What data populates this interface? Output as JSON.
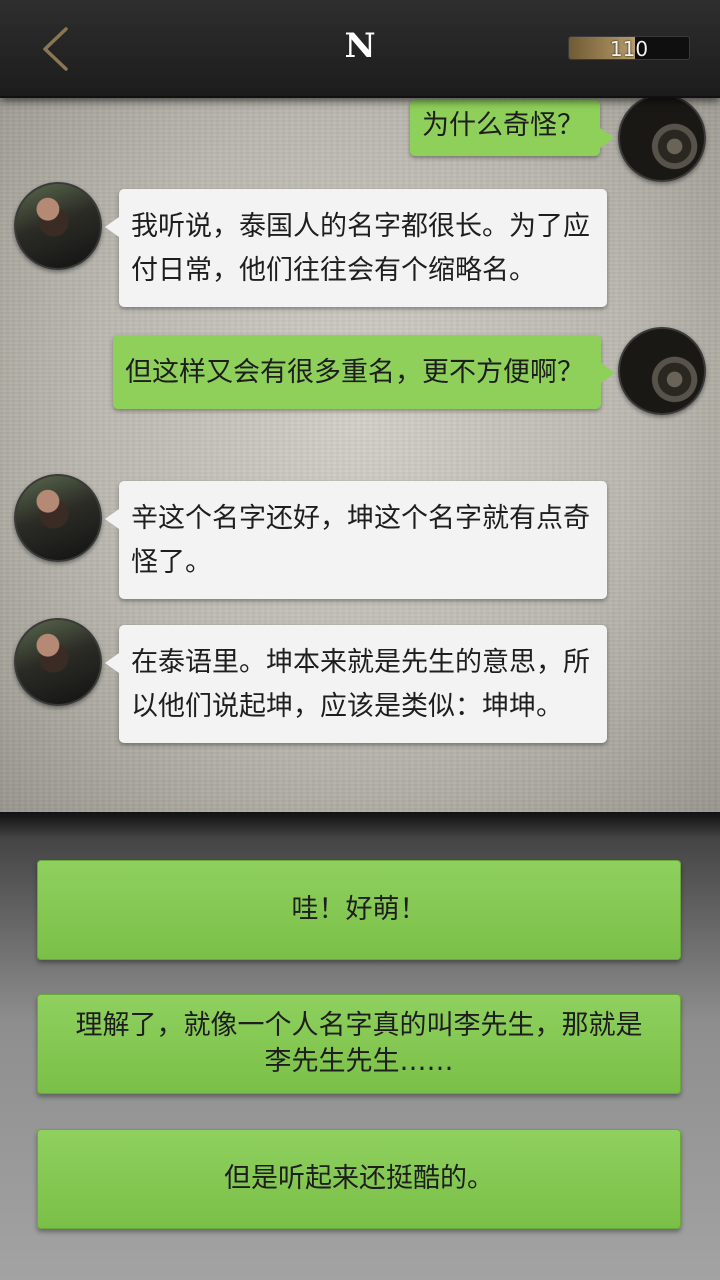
{
  "header": {
    "title": "N",
    "score_value": "110",
    "score_fill_fraction": 0.55
  },
  "messages": [
    {
      "from": "me",
      "text": "为什么奇怪？"
    },
    {
      "from": "other",
      "text": "我听说，泰国人的名字都很长。为了应付日常，他们往往会有个缩略名。"
    },
    {
      "from": "me",
      "text": "但这样又会有很多重名，更不方便啊？"
    },
    {
      "from": "other",
      "text": "辛这个名字还好，坤这个名字就有点奇怪了。"
    },
    {
      "from": "other",
      "text": "在泰语里。坤本来就是先生的意思，所以他们说起坤，应该是类似：坤坤。"
    }
  ],
  "reply_options": [
    {
      "text": "哇！好萌！"
    },
    {
      "text": "理解了，就像一个人名字真的叫李先生，那就是李先生先生……"
    },
    {
      "text": "但是听起来还挺酷的。"
    }
  ],
  "colors": {
    "my_bubble": "#8ed05a",
    "other_bubble": "#f3f3f3",
    "option": "#84c853"
  }
}
